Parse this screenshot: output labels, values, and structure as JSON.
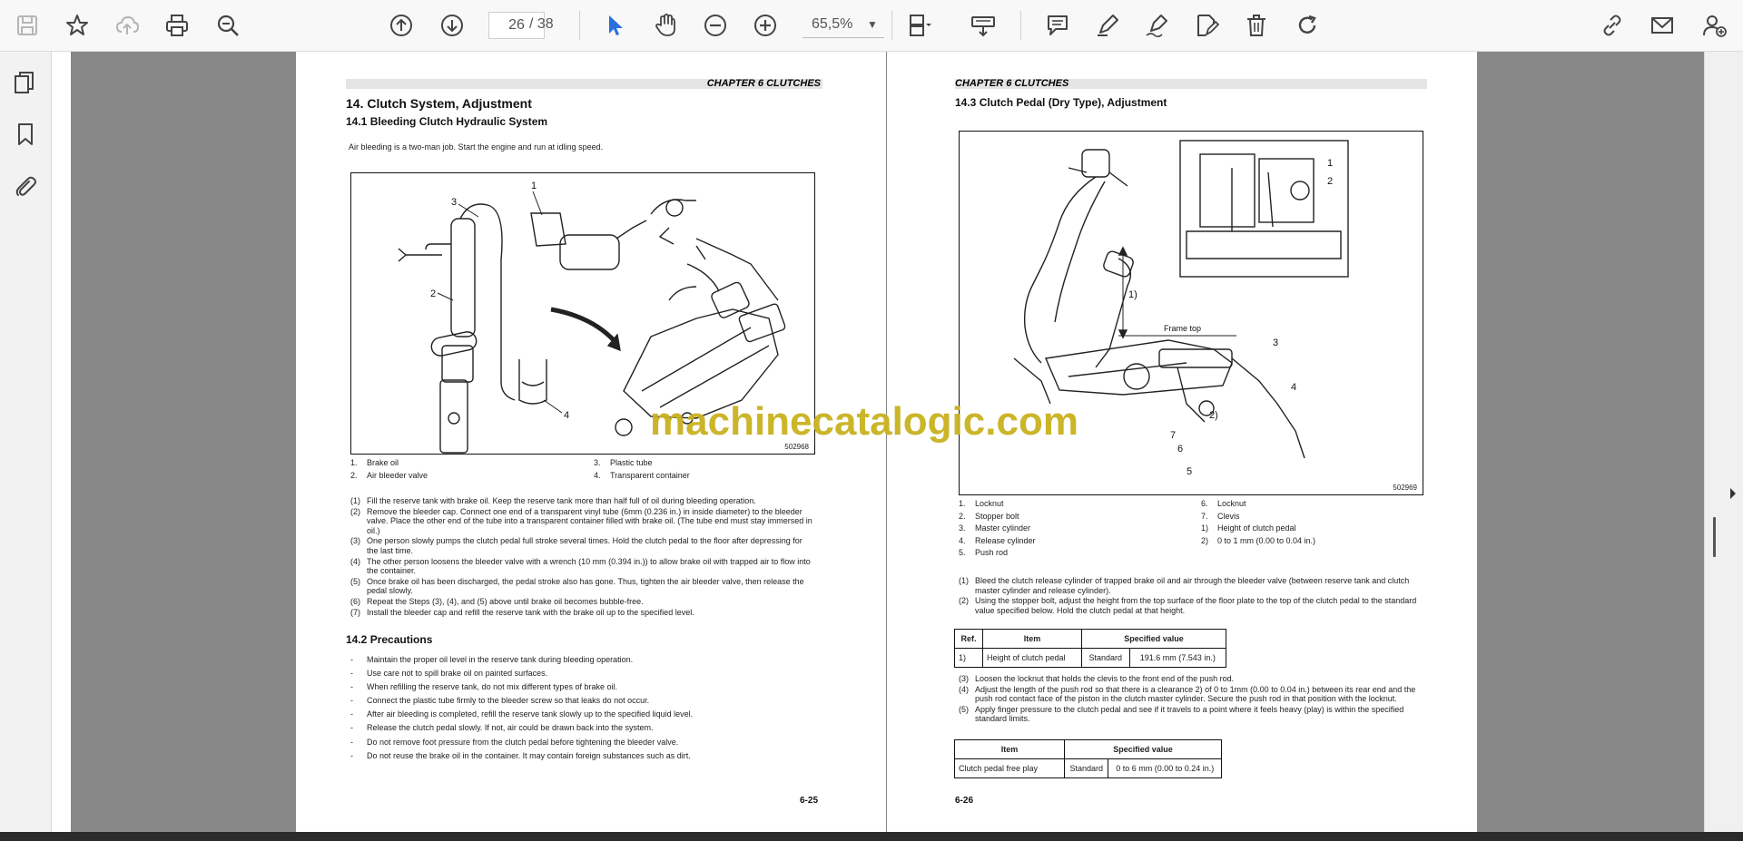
{
  "toolbar": {
    "page_current": "26",
    "page_total": "/ 38",
    "zoom": "65,5%"
  },
  "page_left": {
    "chapter": "CHAPTER 6 CLUTCHES",
    "section_title": "14.  Clutch System, Adjustment",
    "subsection_1": "14.1    Bleeding Clutch Hydraulic System",
    "intro": "Air bleeding is a two-man job. Start the engine and run at idling speed.",
    "figure_id": "502968",
    "callouts": [
      "1",
      "2",
      "3",
      "4"
    ],
    "legend": [
      {
        "n": "1.",
        "label": "Brake oil"
      },
      {
        "n": "2.",
        "label": "Air bleeder valve"
      },
      {
        "n": "3.",
        "label": "Plastic tube"
      },
      {
        "n": "4.",
        "label": "Transparent container"
      }
    ],
    "steps": [
      {
        "n": "(1)",
        "text": "Fill the reserve tank with brake oil. Keep the reserve tank more than half full of oil during bleeding operation."
      },
      {
        "n": "(2)",
        "text": "Remove the bleeder cap. Connect one end of a transparent vinyl tube (6mm (0.236 in.) in inside diameter) to the bleeder valve. Place the other end of the tube into a transparent container filled with brake oil. (The tube end must stay immersed in oil.)"
      },
      {
        "n": "(3)",
        "text": "One person slowly pumps the clutch pedal full stroke several times. Hold the clutch pedal to the floor after depressing for the last time."
      },
      {
        "n": "(4)",
        "text": "The other person loosens the bleeder valve with a wrench (10 mm (0.394 in.)) to allow brake oil with trapped air to flow into the container."
      },
      {
        "n": "(5)",
        "text": "Once brake oil has been discharged, the pedal stroke also has gone. Thus, tighten the air bleeder valve, then release the pedal slowly."
      },
      {
        "n": "(6)",
        "text": "Repeat the Steps (3), (4), and (5) above until brake oil becomes bubble-free."
      },
      {
        "n": "(7)",
        "text": "Install the bleeder cap and refill the reserve tank with the brake oil up to the specified level."
      }
    ],
    "subsection_2": "14.2    Precautions",
    "precautions": [
      "Maintain the proper oil level in the reserve tank during bleeding operation.",
      "Use care not to spill brake oil on painted surfaces.",
      "When refilling the reserve tank, do not mix different types of brake oil.",
      "Connect the plastic tube firmly to the bleeder screw so that leaks do not occur.",
      "After air bleeding is completed, refill the reserve tank slowly up to the specified liquid level.",
      "Release the clutch pedal slowly. If not, air could be drawn back into the system.",
      "Do not remove foot pressure from the clutch pedal before tightening the bleeder valve.",
      "Do not reuse the brake oil in the container. It may contain foreign substances such as dirt."
    ],
    "bullet": "-",
    "page_number": "6-25"
  },
  "page_right": {
    "chapter": "CHAPTER 6 CLUTCHES",
    "subsection_title": "14.3     Clutch Pedal (Dry Type), Adjustment",
    "figure_id": "502969",
    "frame_top": "Frame top",
    "callouts": [
      "1",
      "2",
      "3",
      "4",
      "5",
      "6",
      "7",
      "1)",
      "2)"
    ],
    "legend_left": [
      {
        "n": "1.",
        "label": "Locknut"
      },
      {
        "n": "2.",
        "label": "Stopper bolt"
      },
      {
        "n": "3.",
        "label": "Master cylinder"
      },
      {
        "n": "4.",
        "label": "Release cylinder"
      },
      {
        "n": "5.",
        "label": "Push rod"
      }
    ],
    "legend_right": [
      {
        "n": "6.",
        "label": "Locknut"
      },
      {
        "n": "7.",
        "label": "Clevis"
      },
      {
        "n": "1)",
        "label": "Height of clutch pedal"
      },
      {
        "n": "2)",
        "label": "0 to 1 mm (0.00 to 0.04 in.)"
      }
    ],
    "steps_a": [
      {
        "n": "(1)",
        "text": "Bleed the clutch release cylinder of trapped brake oil and air through the bleeder valve (between reserve tank and clutch master cylinder and release cylinder)."
      },
      {
        "n": "(2)",
        "text": "Using the stopper bolt, adjust the height from the top surface of the floor plate to the top of the clutch pedal to the standard value specified below. Hold the clutch pedal at that height."
      }
    ],
    "table1": {
      "headers": [
        "Ref.",
        "Item",
        "Specified value"
      ],
      "row": [
        "1)",
        "Height of clutch pedal",
        "Standard",
        "191.6 mm (7.543 in.)"
      ]
    },
    "steps_b": [
      {
        "n": "(3)",
        "text": "Loosen the locknut that holds the clevis to the front end of the push rod."
      },
      {
        "n": "(4)",
        "text": "Adjust the length of the push rod so that there is a clearance 2) of 0 to 1mm (0.00 to 0.04 in.) between its rear end and the push rod contact face of the piston in the clutch master cylinder. Secure the push rod in that position with the locknut."
      },
      {
        "n": "(5)",
        "text": "Apply finger pressure to the clutch pedal and see if it travels to a point where it feels heavy (play) is within the specified standard limits."
      }
    ],
    "table2": {
      "headers": [
        "Item",
        "Specified value"
      ],
      "row": [
        "Clutch pedal free play",
        "Standard",
        "0 to 6 mm (0.00 to 0.24 in.)"
      ]
    },
    "page_number": "6-26"
  },
  "watermark": "machinecatalogic.com",
  "colors": {
    "toolbar_bg": "#f8f8f8",
    "viewer_bg": "#878787",
    "active_tool": "#2a6fdb",
    "watermark": "#c9b21e"
  }
}
